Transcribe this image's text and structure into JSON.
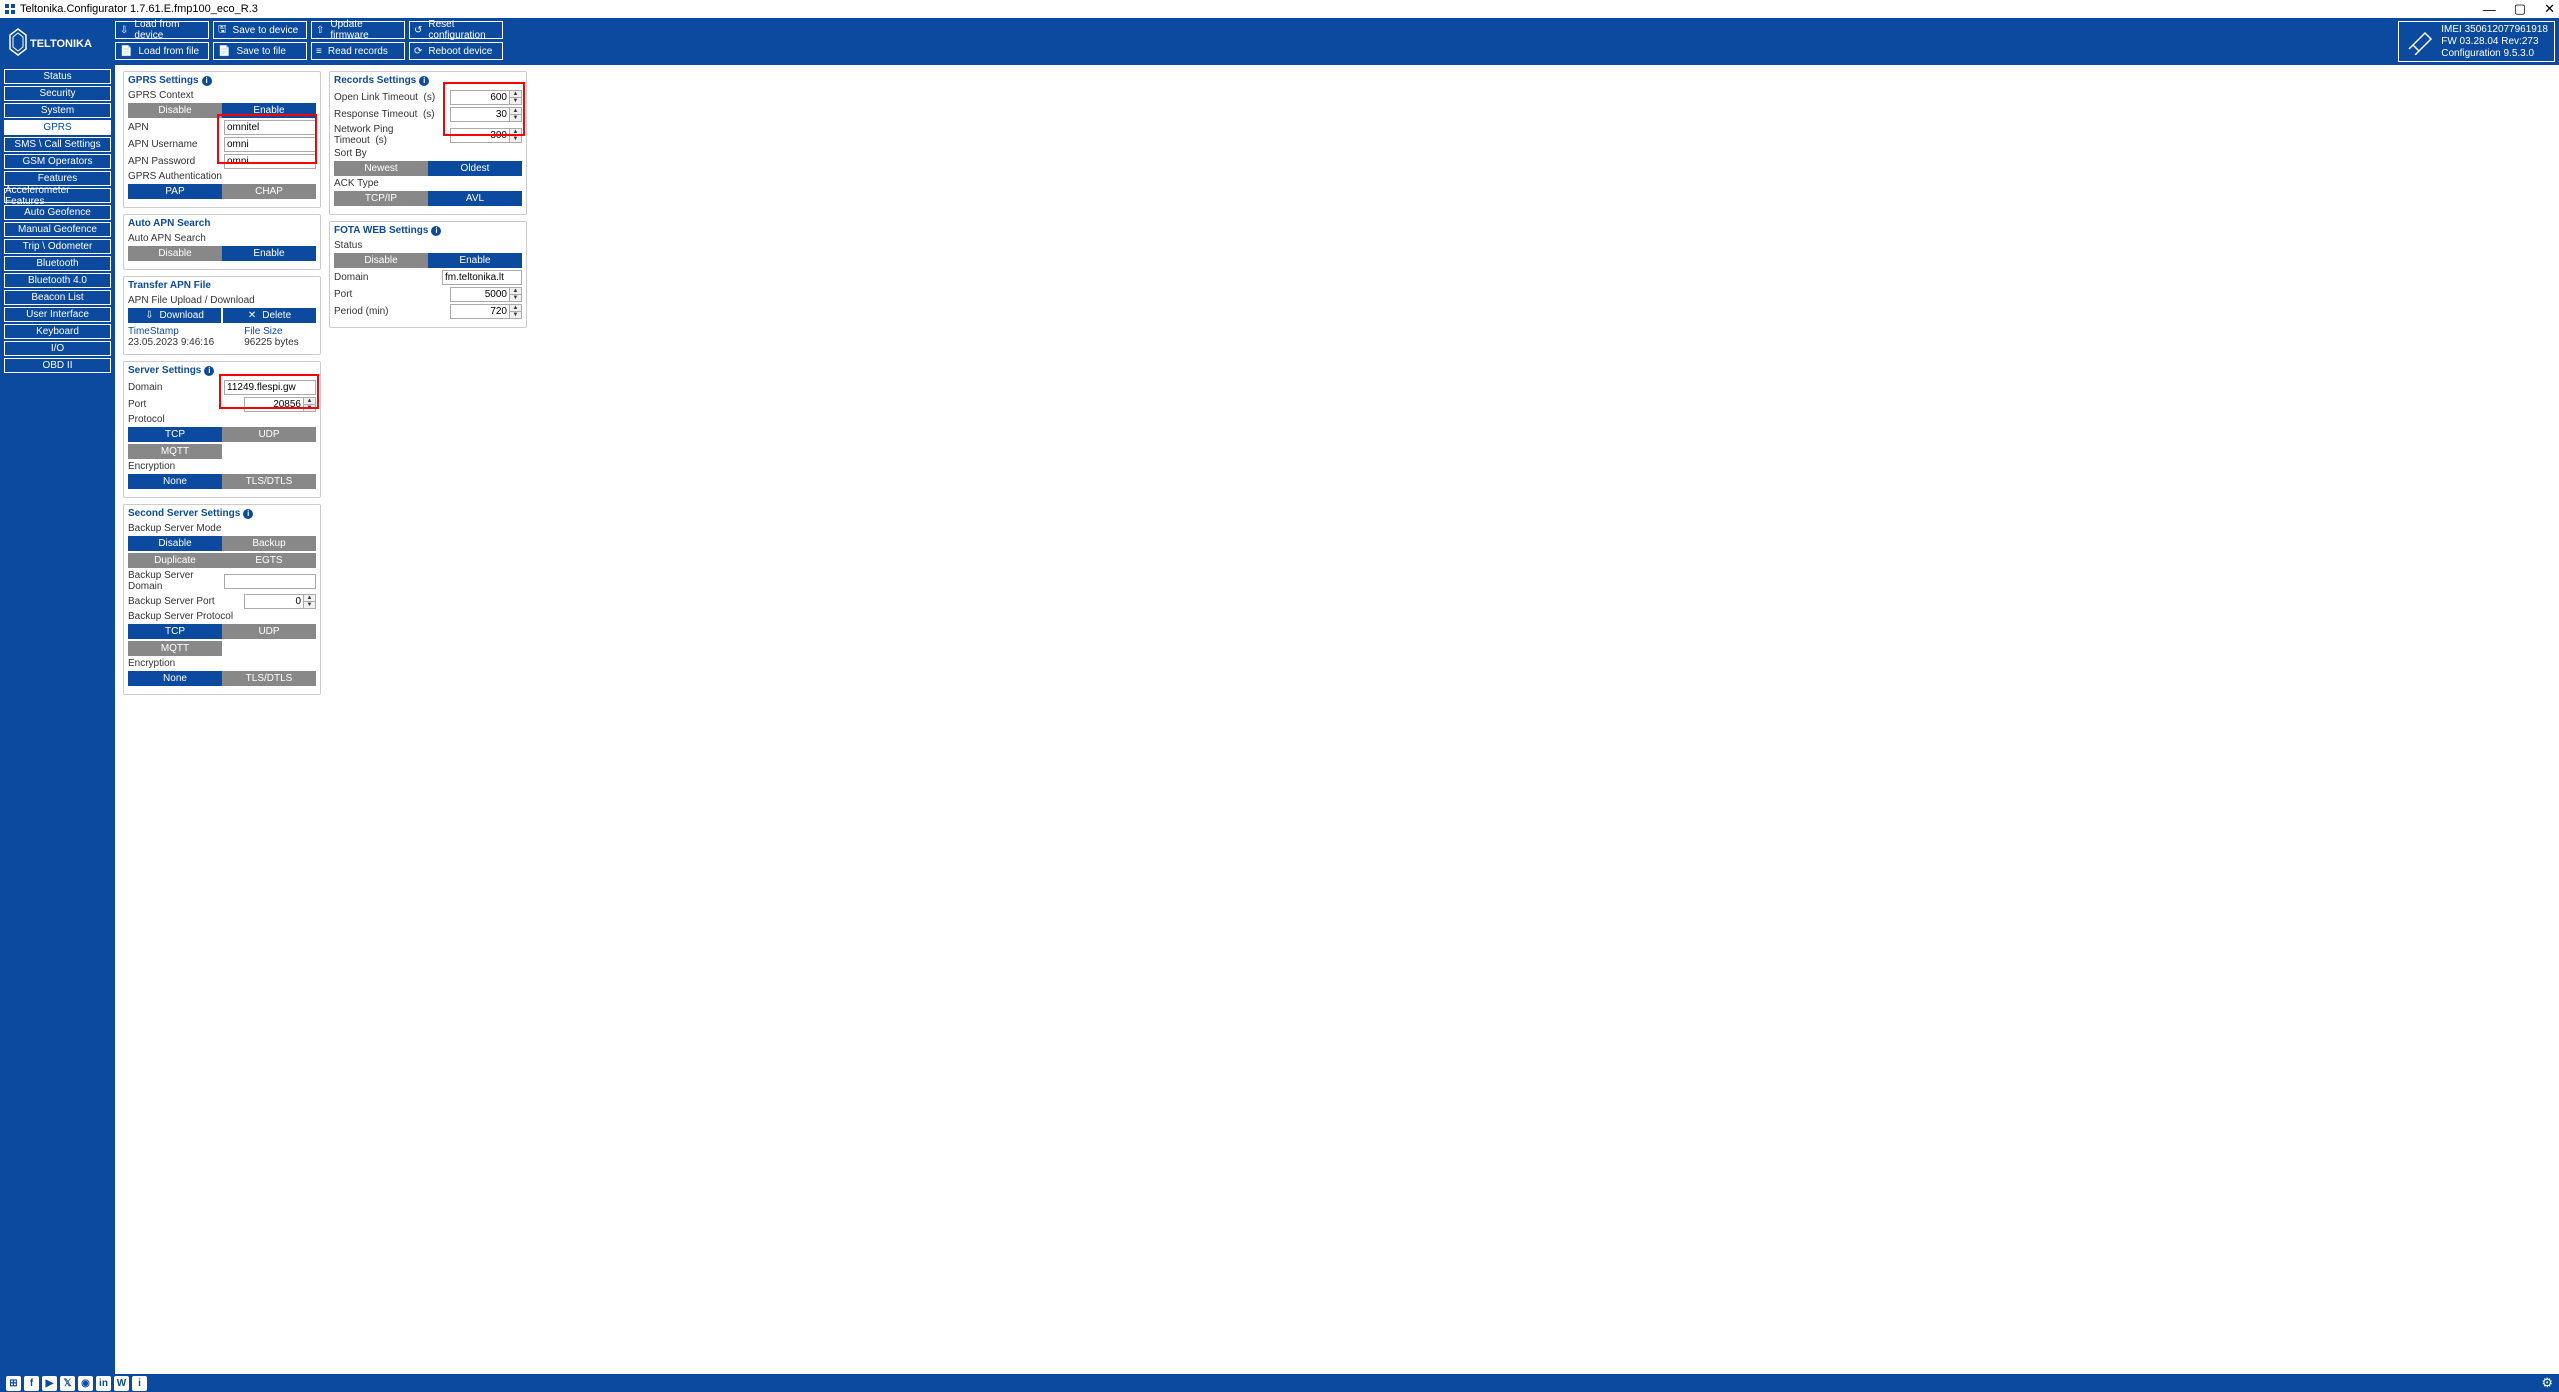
{
  "window": {
    "title": "Teltonika.Configurator 1.7.61.E.fmp100_eco_R.3"
  },
  "toolbar": {
    "load_device": "Load from device",
    "save_device": "Save to device",
    "update_fw": "Update firmware",
    "reset_cfg": "Reset configuration",
    "load_file": "Load from file",
    "save_file": "Save to file",
    "read_records": "Read records",
    "reboot": "Reboot device"
  },
  "device_info": {
    "imei": "IMEI 350612077961918",
    "fw": "FW 03.28.04 Rev:273",
    "cfg": "Configuration 9.5.3.0"
  },
  "sidebar": {
    "items": [
      "Status",
      "Security",
      "System",
      "GPRS",
      "SMS \\ Call Settings",
      "GSM Operators",
      "Features",
      "Accelerometer Features",
      "Auto Geofence",
      "Manual Geofence",
      "Trip \\ Odometer",
      "Bluetooth",
      "Bluetooth 4.0",
      "Beacon List",
      "User Interface",
      "Keyboard",
      "I/O",
      "OBD II"
    ],
    "active": "GPRS"
  },
  "gprs": {
    "title": "GPRS Settings",
    "context_label": "GPRS Context",
    "disable": "Disable",
    "enable": "Enable",
    "apn_label": "APN",
    "apn_value": "omnitel",
    "apn_user_label": "APN Username",
    "apn_user_value": "omni",
    "apn_pass_label": "APN Password",
    "apn_pass_value": "omni",
    "auth_label": "GPRS Authentication",
    "pap": "PAP",
    "chap": "CHAP"
  },
  "autoapn": {
    "title": "Auto APN Search",
    "label": "Auto APN Search",
    "disable": "Disable",
    "enable": "Enable"
  },
  "transfer": {
    "title": "Transfer APN File",
    "upload_label": "APN File Upload / Download",
    "download": "Download",
    "delete": "Delete",
    "ts_label": "TimeStamp",
    "ts_value": "23.05.2023 9:46:16",
    "fs_label": "File Size",
    "fs_value": "96225 bytes"
  },
  "server": {
    "title": "Server Settings",
    "domain_label": "Domain",
    "domain_value": "11249.flespi.gw",
    "port_label": "Port",
    "port_value": "20856",
    "protocol_label": "Protocol",
    "tcp": "TCP",
    "udp": "UDP",
    "mqtt": "MQTT",
    "enc_label": "Encryption",
    "none": "None",
    "tls": "TLS/DTLS"
  },
  "second": {
    "title": "Second Server Settings",
    "mode_label": "Backup Server Mode",
    "disable": "Disable",
    "backup": "Backup",
    "duplicate": "Duplicate",
    "egts": "EGTS",
    "domain_label": "Backup Server Domain",
    "domain_value": "",
    "port_label": "Backup Server Port",
    "port_value": "0",
    "protocol_label": "Backup Server Protocol",
    "tcp": "TCP",
    "udp": "UDP",
    "mqtt": "MQTT",
    "enc_label": "Encryption",
    "none": "None",
    "tls": "TLS/DTLS"
  },
  "records": {
    "title": "Records Settings",
    "olt_label": "Open Link Timeout",
    "olt_unit": "(s)",
    "olt_value": "600",
    "rt_label": "Response Timeout",
    "rt_unit": "(s)",
    "rt_value": "30",
    "npt_label": "Network Ping Timeout",
    "npt_unit": "(s)",
    "npt_value": "300",
    "sort_label": "Sort By",
    "newest": "Newest",
    "oldest": "Oldest",
    "ack_label": "ACK Type",
    "tcpip": "TCP/IP",
    "avl": "AVL"
  },
  "fota": {
    "title": "FOTA WEB Settings",
    "status_label": "Status",
    "disable": "Disable",
    "enable": "Enable",
    "domain_label": "Domain",
    "domain_value": "fm.teltonika.lt",
    "port_label": "Port",
    "port_value": "5000",
    "period_label": "Period (min)",
    "period_value": "720"
  }
}
